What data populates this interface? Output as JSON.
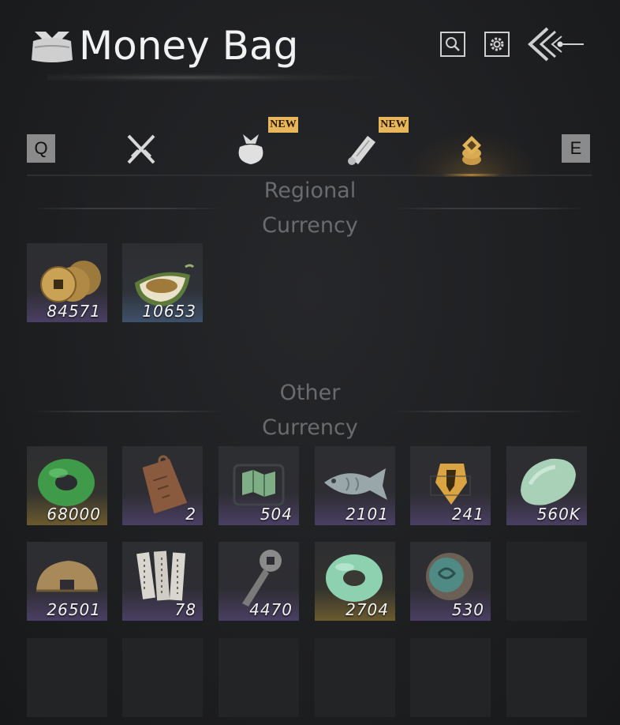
{
  "header": {
    "title": "Money Bag"
  },
  "tabs": {
    "key_prev": "Q",
    "key_next": "E",
    "badges": {
      "bag": "NEW",
      "scroll": "NEW"
    }
  },
  "sections": {
    "regional": {
      "title_line1": "Regional",
      "title_line2": "Currency"
    },
    "other": {
      "title_line1": "Other",
      "title_line2": "Currency"
    }
  },
  "regional_items": [
    {
      "icon": "copper-coins-icon",
      "count": "84571",
      "rarity": "purple"
    },
    {
      "icon": "melon-seeds-icon",
      "count": "10653",
      "rarity": "blue"
    }
  ],
  "other_items": [
    {
      "icon": "green-jade-disc-icon",
      "count": "68000",
      "rarity": "gold"
    },
    {
      "icon": "bronze-token-icon",
      "count": "2",
      "rarity": "purple"
    },
    {
      "icon": "map-fragment-icon",
      "count": "504",
      "rarity": "purple"
    },
    {
      "icon": "fish-carving-icon",
      "count": "2101",
      "rarity": "purple"
    },
    {
      "icon": "gold-pen-badge-icon",
      "count": "241",
      "rarity": "purple"
    },
    {
      "icon": "jade-stone-icon",
      "count": "560K",
      "rarity": "purple"
    },
    {
      "icon": "bronze-half-coin-icon",
      "count": "26501",
      "rarity": "purple"
    },
    {
      "icon": "bamboo-slips-icon",
      "count": "78",
      "rarity": "purple"
    },
    {
      "icon": "key-coin-icon",
      "count": "4470",
      "rarity": "purple"
    },
    {
      "icon": "pale-jade-disc-icon",
      "count": "2704",
      "rarity": "gold"
    },
    {
      "icon": "dragon-seal-icon",
      "count": "530",
      "rarity": "purple"
    }
  ]
}
